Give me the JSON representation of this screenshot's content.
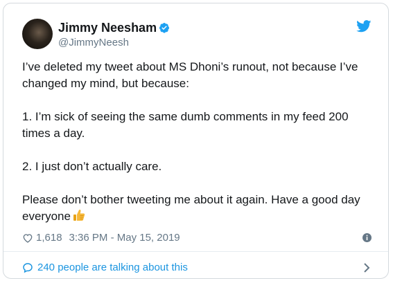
{
  "tweet": {
    "author_name": "Jimmy Neesham",
    "handle": "@JimmyNeesh",
    "paragraphs": [
      "I’ve deleted my tweet about MS Dhoni’s runout, not because I’ve changed my mind, but because:",
      "1. I’m sick of seeing the same dumb comments in my feed 200 times a day.",
      "2. I just don’t actually care.",
      "Please don’t bother tweeting me about it again. Have a good day everyone"
    ],
    "likes": "1,618",
    "timestamp": "3:36 PM - May 15, 2019",
    "conversation": "240 people are talking about this"
  },
  "colors": {
    "twitter_blue": "#1da1f2",
    "link_blue": "#1b95e0",
    "muted_gray": "#657786",
    "emoji_yellow": "#f6b93b"
  },
  "icons": [
    "verified-badge-icon",
    "twitter-bird-icon",
    "heart-icon",
    "thumbs-up-emoji-icon",
    "info-icon",
    "speech-bubble-icon",
    "chevron-right-icon"
  ]
}
